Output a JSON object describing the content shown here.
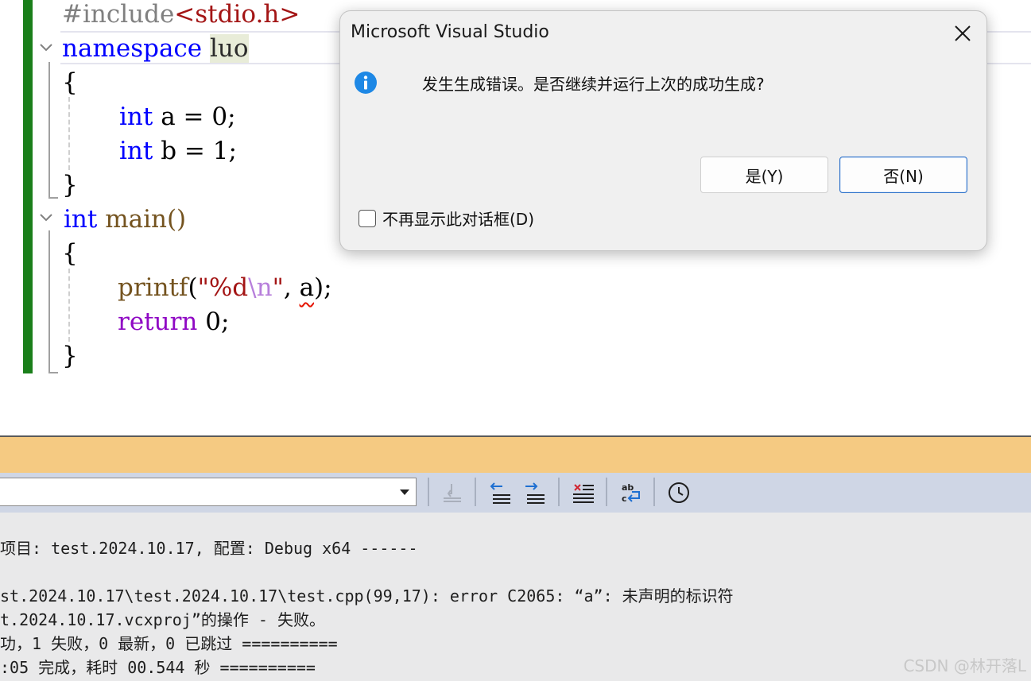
{
  "editor": {
    "lines": {
      "include": {
        "directive": "#include",
        "header": "<stdio.h>"
      },
      "namespace": {
        "keyword": "namespace",
        "name": "luo"
      },
      "open_brace_1": "{",
      "decl_a": {
        "type": "int",
        "rest": " a = 0;"
      },
      "decl_b": {
        "type": "int",
        "rest": " b = 1;"
      },
      "close_brace_1": "}",
      "main_sig": {
        "type": "int",
        "rest": " main()"
      },
      "open_brace_2": "{",
      "printf": {
        "fn": "printf",
        "open": "(",
        "fmt": "\"%d",
        "esc": "\\n",
        "close_q": "\"",
        "comma": ", ",
        "arg": "a",
        "tail": ");"
      },
      "return": {
        "keyword": "return",
        "rest": " 0;"
      },
      "close_brace_2": "}"
    },
    "error_squiggle_color": "#e51400",
    "change_bar_color": "#1a7f1a"
  },
  "dialog": {
    "title": "Microsoft Visual Studio",
    "message": "发生生成错误。是否继续并运行上次的成功生成?",
    "yes_button": "是(Y)",
    "no_button": "否(N)",
    "checkbox_label": "不再显示此对话框(D)",
    "checkbox_checked": false,
    "icon": "info-icon",
    "icon_color": "#1e88e5"
  },
  "output_panel": {
    "title_bar_color": "#f5ca82",
    "source_dropdown_value": "",
    "toolbar_icons": [
      "go-to-build-icon",
      "previous-message-icon",
      "next-message-icon",
      "clear-all-icon",
      "word-wrap-icon",
      "timestamps-icon"
    ],
    "lines": [
      "项目: test.2024.10.17, 配置: Debug x64 ------",
      "",
      "st.2024.10.17\\test.2024.10.17\\test.cpp(99,17): error C2065: “a”: 未声明的标识符",
      "t.2024.10.17.vcxproj”的操作 - 失败。",
      "功，1 失败，0 最新，0 已跳过 ==========",
      ":05 完成，耗时 00.544 秒 =========="
    ]
  },
  "watermark": "CSDN @林开落L"
}
